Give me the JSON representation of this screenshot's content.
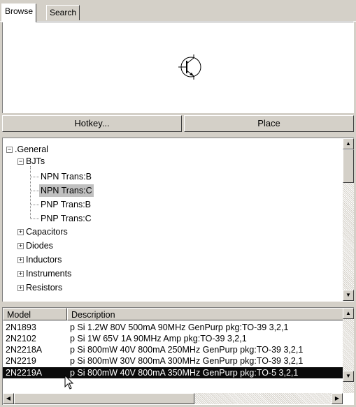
{
  "tabs": [
    {
      "label": "Browse"
    },
    {
      "label": "Search"
    }
  ],
  "buttons": {
    "hotkey": "Hotkey...",
    "place": "Place"
  },
  "tree": {
    "general": "General",
    "bjts": "BJTs",
    "npn_b": "NPN Trans:B",
    "npn_c": "NPN Trans:C",
    "pnp_b": "PNP Trans:B",
    "pnp_c": "PNP Trans:C",
    "capacitors": "Capacitors",
    "diodes": "Diodes",
    "inductors": "Inductors",
    "instruments": "Instruments",
    "resistors": "Resistors"
  },
  "list": {
    "col_model": "Model",
    "col_desc": "Description",
    "rows": [
      {
        "model": "2N1893",
        "desc": "p Si 1.2W 80V 500mA 90MHz GenPurp pkg:TO-39 3,2,1"
      },
      {
        "model": "2N2102",
        "desc": "p Si 1W 65V 1A 90MHz Amp pkg:TO-39 3,2,1"
      },
      {
        "model": "2N2218A",
        "desc": "p Si 800mW 40V 800mA 250MHz GenPurp pkg:TO-39 3,2,1"
      },
      {
        "model": "2N2219",
        "desc": "p Si 800mW 30V 800mA 300MHz GenPurp pkg:TO-39 3,2,1"
      },
      {
        "model": "2N2219A",
        "desc": "p Si 800mW 40V 800mA 350MHz GenPurp pkg:TO-5 3,2,1"
      }
    ]
  }
}
